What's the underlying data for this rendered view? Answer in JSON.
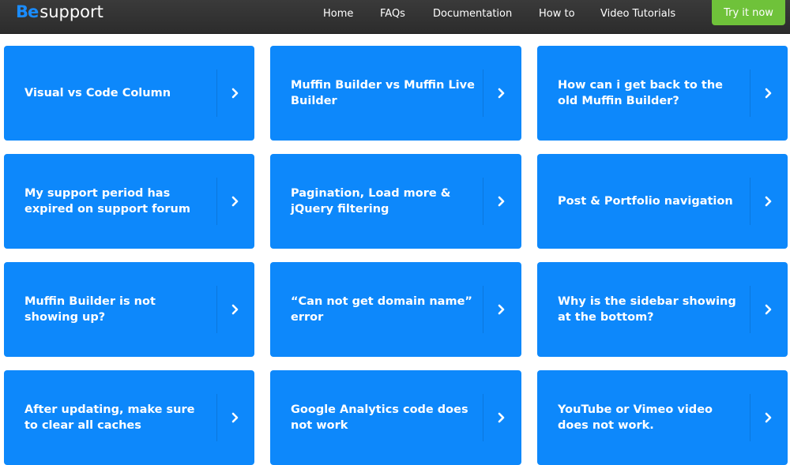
{
  "brand": {
    "logo_be": "Be",
    "logo_support": "support"
  },
  "nav": {
    "items": [
      {
        "label": "Home"
      },
      {
        "label": "FAQs"
      },
      {
        "label": "Documentation"
      },
      {
        "label": "How to"
      },
      {
        "label": "Video Tutorials"
      }
    ],
    "cta_label": "Try it now"
  },
  "colors": {
    "topbar": "#2f2f2f",
    "brand_blue": "#1a8cff",
    "card_blue": "#0d88fb",
    "cta_green": "#6fc23a"
  },
  "cards": [
    {
      "title": "Visual vs Code Column",
      "icon": "chevron-right-icon"
    },
    {
      "title": "Muffin Builder vs Muffin Live Builder",
      "icon": "chevron-right-icon"
    },
    {
      "title": "How can i get back to the old Muffin Builder?",
      "icon": "chevron-right-icon"
    },
    {
      "title": "My support period has expired on support forum",
      "icon": "chevron-right-icon"
    },
    {
      "title": "Pagination, Load more & jQuery filtering",
      "icon": "chevron-right-icon"
    },
    {
      "title": "Post & Portfolio navigation",
      "icon": "chevron-right-icon"
    },
    {
      "title": "Muffin Builder is not showing up?",
      "icon": "chevron-right-icon"
    },
    {
      "title": "“Can not get domain name” error",
      "icon": "chevron-right-icon"
    },
    {
      "title": "Why is the sidebar showing at the bottom?",
      "icon": "chevron-right-icon"
    },
    {
      "title": "After updating, make sure to clear all caches",
      "icon": "chevron-right-icon"
    },
    {
      "title": "Google Analytics code does not work",
      "icon": "chevron-right-icon"
    },
    {
      "title": "YouTube or Vimeo video does not work.",
      "icon": "chevron-right-icon"
    }
  ]
}
